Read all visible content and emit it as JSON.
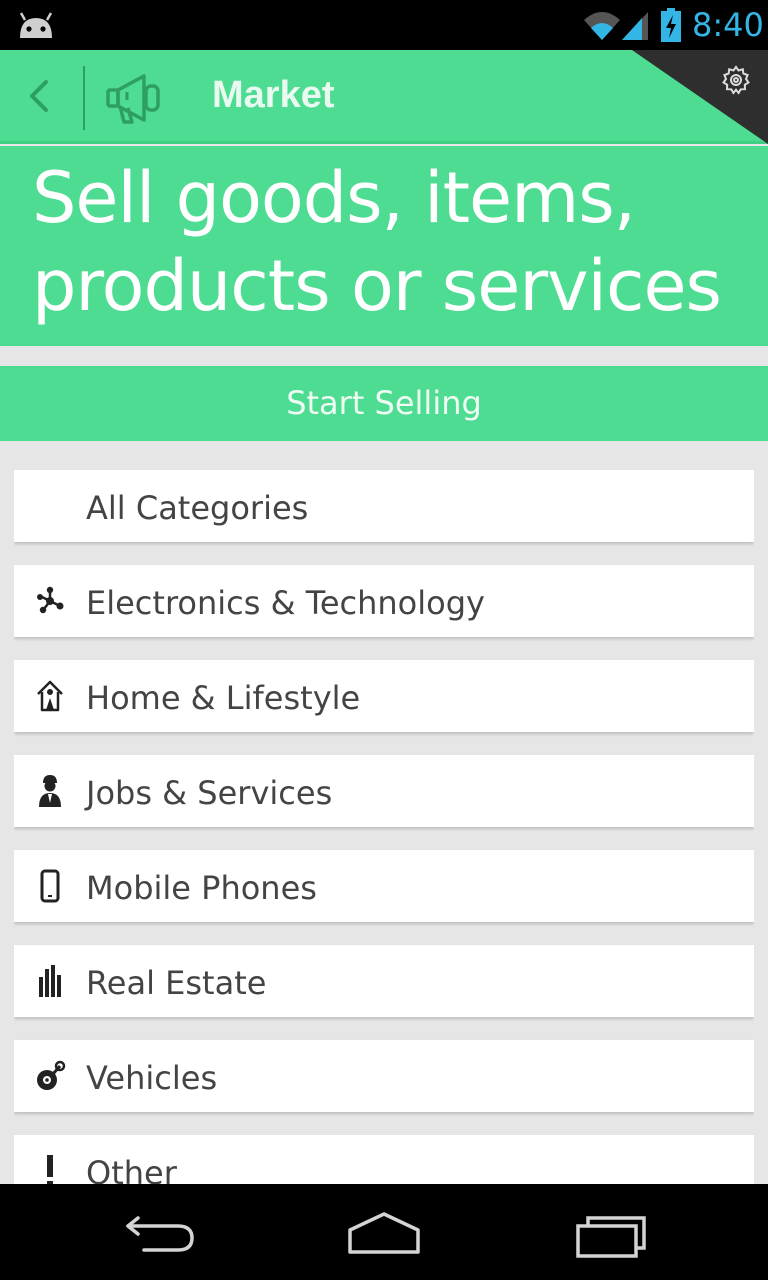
{
  "status_bar": {
    "time": "8:40",
    "time_color": "#33b5e5"
  },
  "action_bar": {
    "title": "Market",
    "background": "#4ddc91",
    "icons": [
      "back-arrow-icon",
      "megaphone-icon",
      "gear-icon"
    ]
  },
  "hero": {
    "title": "Sell goods, items, products or services"
  },
  "start_selling": {
    "label": "Start Selling"
  },
  "categories": [
    {
      "label": "All Categories",
      "icon": ""
    },
    {
      "label": "Electronics & Technology",
      "icon": "network-nodes-icon"
    },
    {
      "label": "Home & Lifestyle",
      "icon": "house-icon"
    },
    {
      "label": "Jobs & Services",
      "icon": "worker-icon"
    },
    {
      "label": "Mobile Phones",
      "icon": "mobile-phone-icon"
    },
    {
      "label": "Real Estate",
      "icon": "buildings-icon"
    },
    {
      "label": "Vehicles",
      "icon": "wheel-icon"
    },
    {
      "label": "Other",
      "icon": "exclamation-icon"
    }
  ],
  "nav_bar": {
    "icons": [
      "nav-back-icon",
      "nav-home-icon",
      "nav-recent-apps-icon"
    ]
  }
}
